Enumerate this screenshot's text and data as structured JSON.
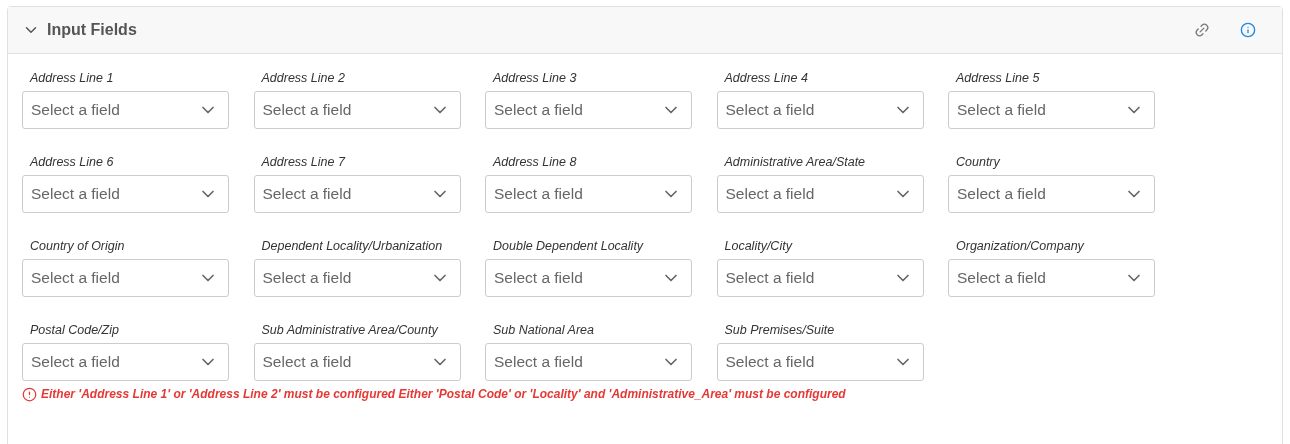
{
  "panel": {
    "title": "Input Fields",
    "expanded": true
  },
  "fields": [
    {
      "label": "Address Line 1",
      "placeholder": "Select a field"
    },
    {
      "label": "Address Line 2",
      "placeholder": "Select a field"
    },
    {
      "label": "Address Line 3",
      "placeholder": "Select a field"
    },
    {
      "label": "Address Line 4",
      "placeholder": "Select a field"
    },
    {
      "label": "Address Line 5",
      "placeholder": "Select a field"
    },
    {
      "label": "Address Line 6",
      "placeholder": "Select a field"
    },
    {
      "label": "Address Line 7",
      "placeholder": "Select a field"
    },
    {
      "label": "Address Line 8",
      "placeholder": "Select a field"
    },
    {
      "label": "Administrative Area/State",
      "placeholder": "Select a field"
    },
    {
      "label": "Country",
      "placeholder": "Select a field"
    },
    {
      "label": "Country of Origin",
      "placeholder": "Select a field"
    },
    {
      "label": "Dependent Locality/Urbanization",
      "placeholder": "Select a field"
    },
    {
      "label": "Double Dependent Locality",
      "placeholder": "Select a field"
    },
    {
      "label": "Locality/City",
      "placeholder": "Select a field"
    },
    {
      "label": "Organization/Company",
      "placeholder": "Select a field"
    },
    {
      "label": "Postal Code/Zip",
      "placeholder": "Select a field"
    },
    {
      "label": "Sub Administrative Area/County",
      "placeholder": "Select a field"
    },
    {
      "label": "Sub National Area",
      "placeholder": "Select a field"
    },
    {
      "label": "Sub Premises/Suite",
      "placeholder": "Select a field"
    }
  ],
  "error": "Either 'Address Line 1' or 'Address Line 2' must be configured Either 'Postal Code' or 'Locality' and 'Administrative_Area' must be configured"
}
